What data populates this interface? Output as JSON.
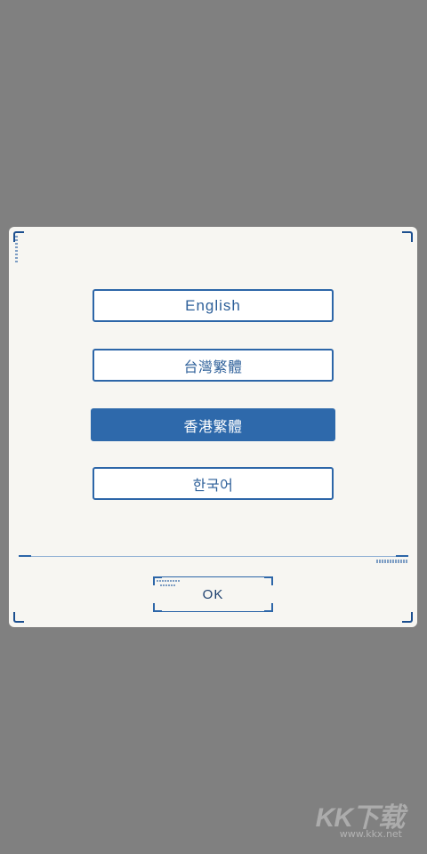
{
  "dialog": {
    "languages": [
      {
        "label": "English",
        "selected": false
      },
      {
        "label": "台灣繁體",
        "selected": false
      },
      {
        "label": "香港繁體",
        "selected": true
      },
      {
        "label": "한국어",
        "selected": false
      }
    ],
    "ok_label": "OK"
  },
  "watermark": {
    "logo": "KK下载",
    "url": "www.kkx.net"
  },
  "colors": {
    "backdrop": "#808080",
    "dialog_bg": "#f7f6f2",
    "accent": "#2e69ab",
    "text": "#2d5f99"
  }
}
